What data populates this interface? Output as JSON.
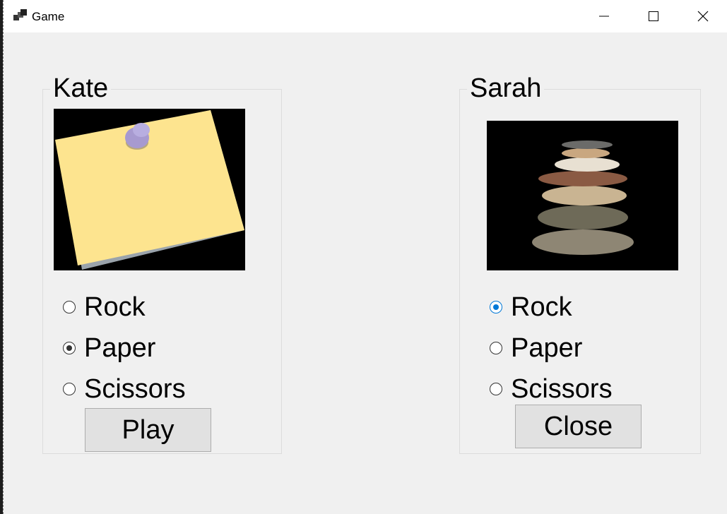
{
  "window": {
    "title": "Game",
    "app_icon": "app-windows-icon",
    "controls": [
      "minimize-icon",
      "maximize-icon",
      "close-icon"
    ]
  },
  "players": [
    {
      "name": "Kate",
      "image": "sticky-note-pin",
      "options": [
        {
          "label": "Rock",
          "selected": false
        },
        {
          "label": "Paper",
          "selected": true
        },
        {
          "label": "Scissors",
          "selected": false
        }
      ],
      "button_label": "Play"
    },
    {
      "name": "Sarah",
      "image": "stacked-stones",
      "options": [
        {
          "label": "Rock",
          "selected": true
        },
        {
          "label": "Paper",
          "selected": false
        },
        {
          "label": "Scissors",
          "selected": false
        }
      ],
      "button_label": "Close"
    }
  ],
  "colors": {
    "window_bg": "#f0f0f0",
    "titlebar_bg": "#ffffff",
    "accent": "#0078d7",
    "button_bg": "#e1e1e1"
  }
}
